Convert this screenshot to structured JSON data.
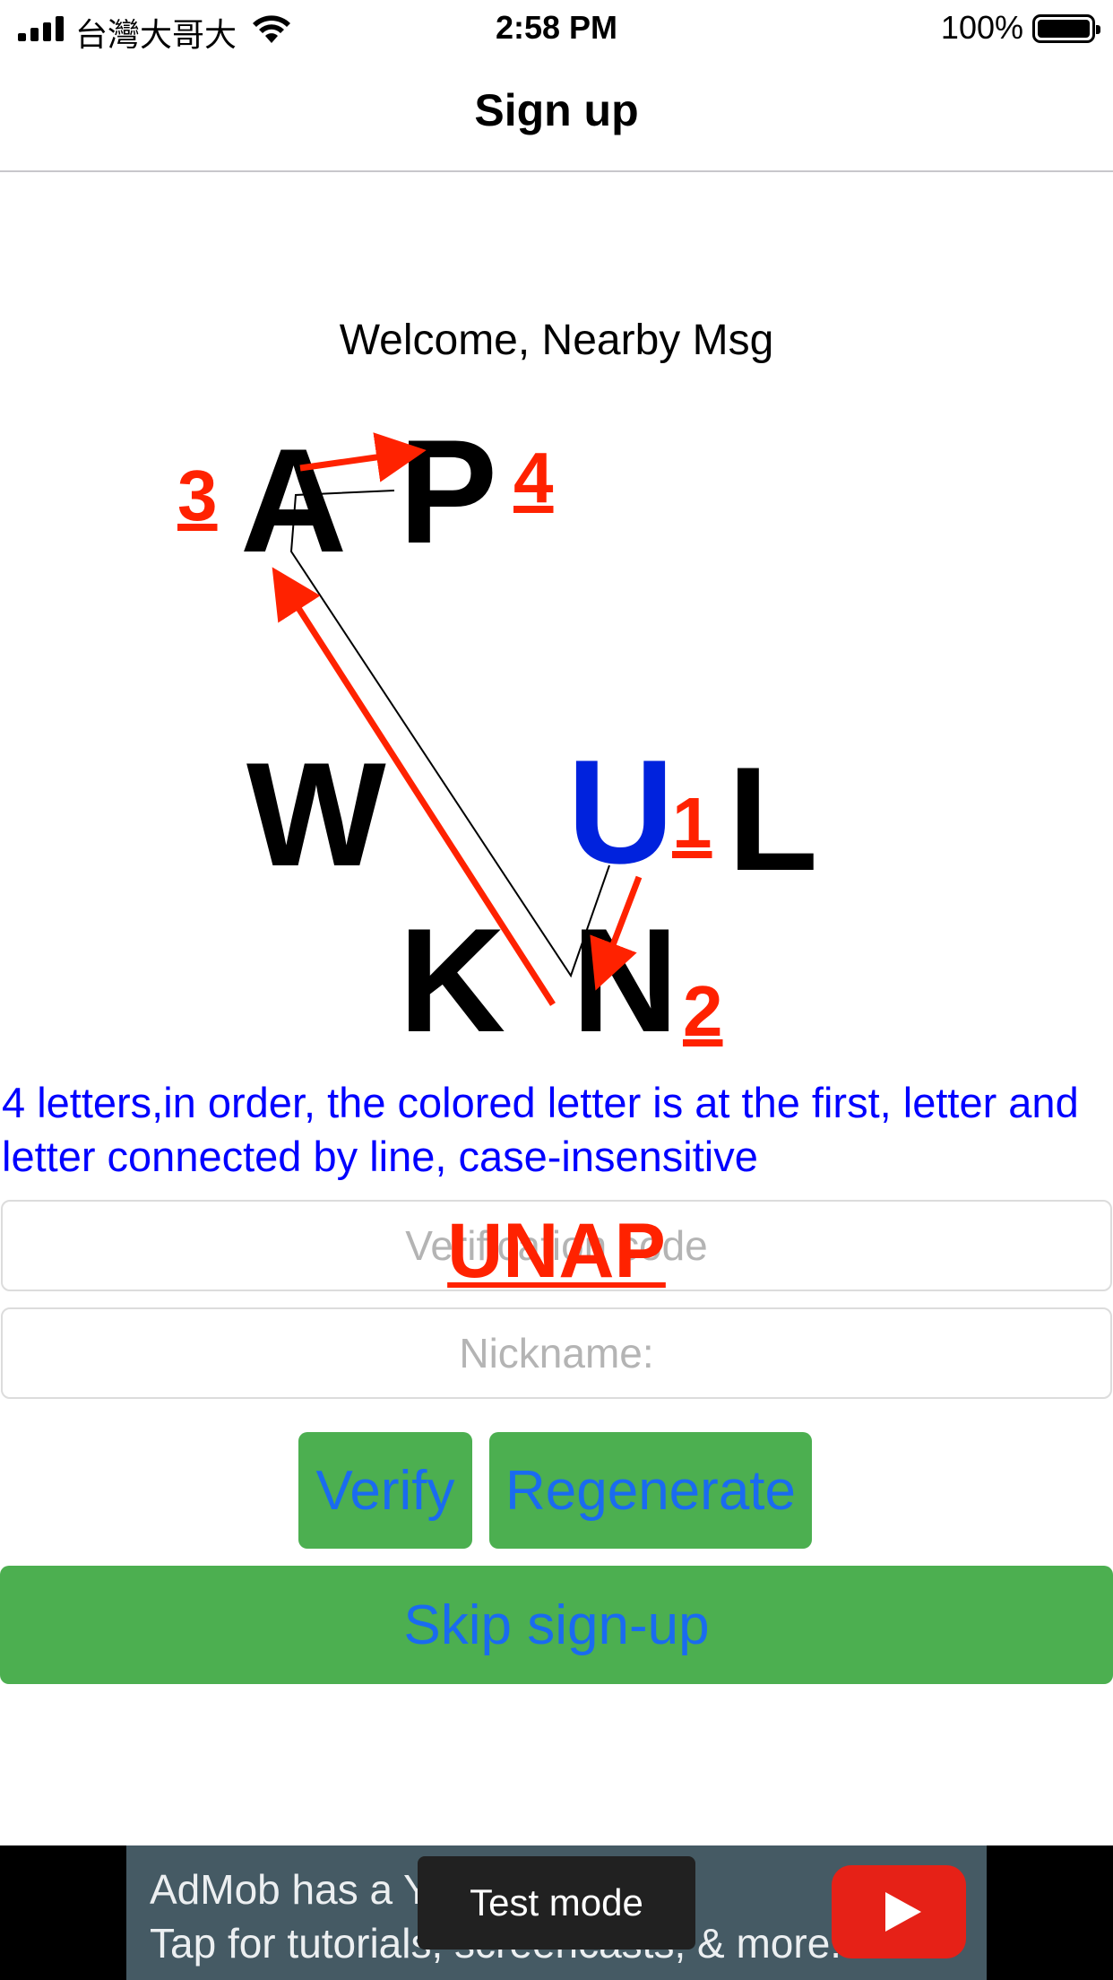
{
  "status_bar": {
    "carrier": "台灣大哥大",
    "time": "2:58 PM",
    "battery_percent": "100%"
  },
  "nav": {
    "title": "Sign up"
  },
  "welcome": "Welcome, Nearby Msg",
  "captcha": {
    "letters": [
      "A",
      "P",
      "W",
      "U",
      "L",
      "K",
      "N"
    ],
    "highlighted_letter": "U",
    "letter_color": "#000000",
    "highlight_color": "#0022dd",
    "annotation_color": "#ff2200",
    "annotations": [
      "1",
      "2",
      "3",
      "4"
    ]
  },
  "instructions": "4 letters,in order, the colored letter is at the first, letter and letter connected by line, case-insensitive",
  "fields": {
    "code_placeholder": "Verification code",
    "nickname_placeholder": "Nickname:"
  },
  "annotation_answer": "UNAP",
  "buttons": {
    "verify": "Verify",
    "regenerate": "Regenerate",
    "skip": "Skip sign-up"
  },
  "ad": {
    "line1": "AdMob has a Yo",
    "line2": "Tap for tutorials, screencasts, & more.",
    "test_mode": "Test mode",
    "icon": "youtube-play-icon"
  }
}
